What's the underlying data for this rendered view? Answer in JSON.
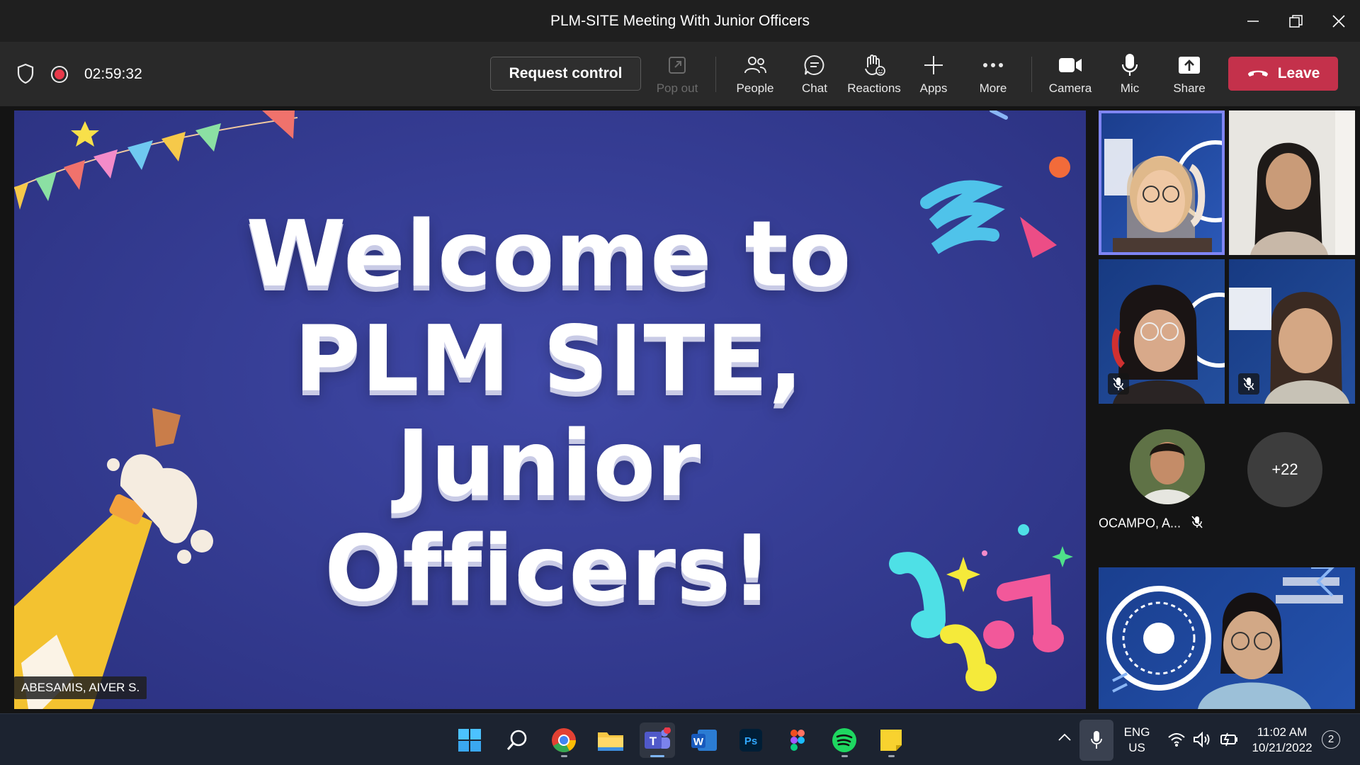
{
  "window": {
    "title": "PLM-SITE Meeting With Junior Officers"
  },
  "toolbar": {
    "timer": "02:59:32",
    "request_control": "Request control",
    "popout": "Pop out",
    "people": "People",
    "chat": "Chat",
    "reactions": "Reactions",
    "apps": "Apps",
    "more": "More",
    "camera": "Camera",
    "mic": "Mic",
    "share": "Share",
    "leave": "Leave"
  },
  "shared_screen": {
    "slide_title_lines": [
      "Welcome to",
      "PLM SITE,",
      "Junior",
      "Officers!"
    ],
    "presenter": "ABESAMIS, AIVER S."
  },
  "participants": {
    "audio_only_name": "OCAMPO, A...",
    "overflow_count": "+22"
  },
  "taskbar": {
    "language_line1": "ENG",
    "language_line2": "US",
    "time": "11:02 AM",
    "date": "10/21/2022",
    "notification_count": "2"
  },
  "colors": {
    "leave": "#c4314b",
    "active_speaker": "#7f85f5",
    "record": "#e8394a",
    "slide_bg": "#333a8f"
  }
}
